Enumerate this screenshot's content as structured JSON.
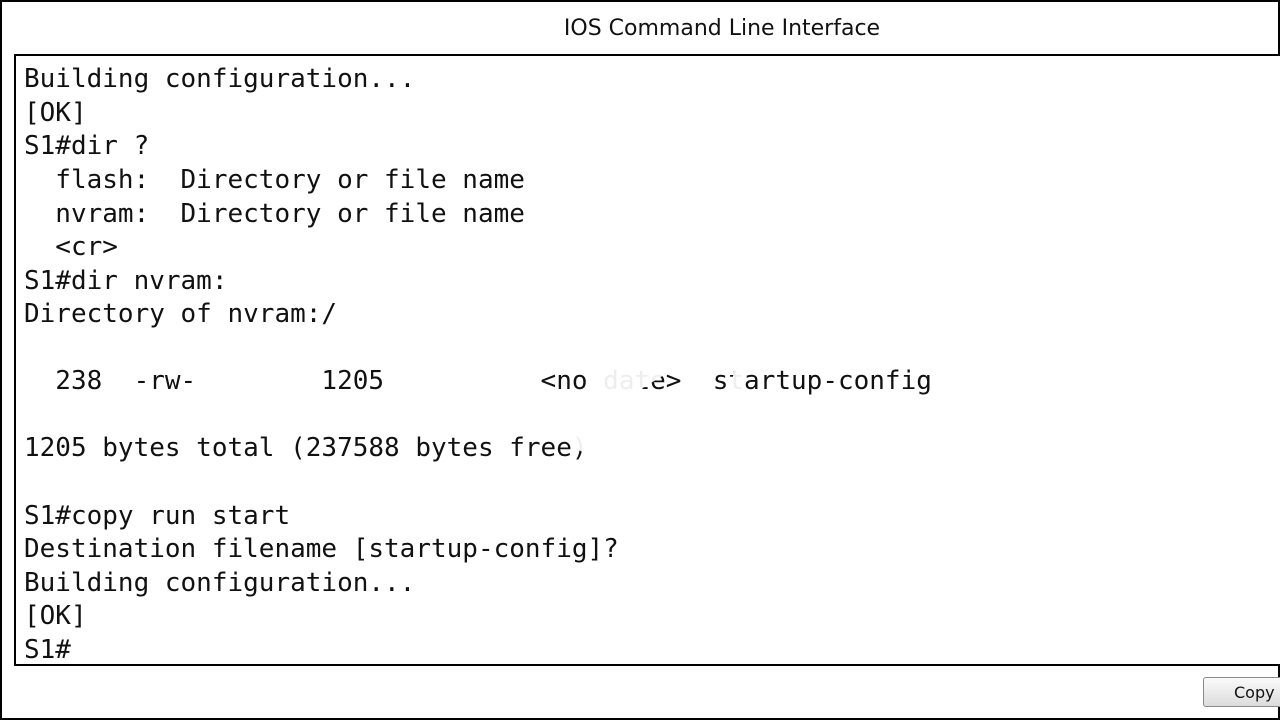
{
  "window": {
    "title": "IOS Command Line Interface"
  },
  "terminal": {
    "lines": [
      "Building configuration...",
      "[OK]",
      "S1#dir ?",
      "  flash:  Directory or file name",
      "  nvram:  Directory or file name",
      "  <cr>",
      "S1#dir nvram:",
      "Directory of nvram:/",
      "",
      "  238  -rw-        1205          <no date>  startup-config",
      "",
      "1205 bytes total (237588 bytes free)",
      "",
      "S1#copy run start",
      "Destination filename [startup-config]?",
      "Building configuration...",
      "[OK]",
      "S1#"
    ]
  },
  "buttons": {
    "copy_label": "Copy"
  },
  "overlay": {
    "icon": "play-icon",
    "color": "#ffffff",
    "opacity": 0.9
  }
}
